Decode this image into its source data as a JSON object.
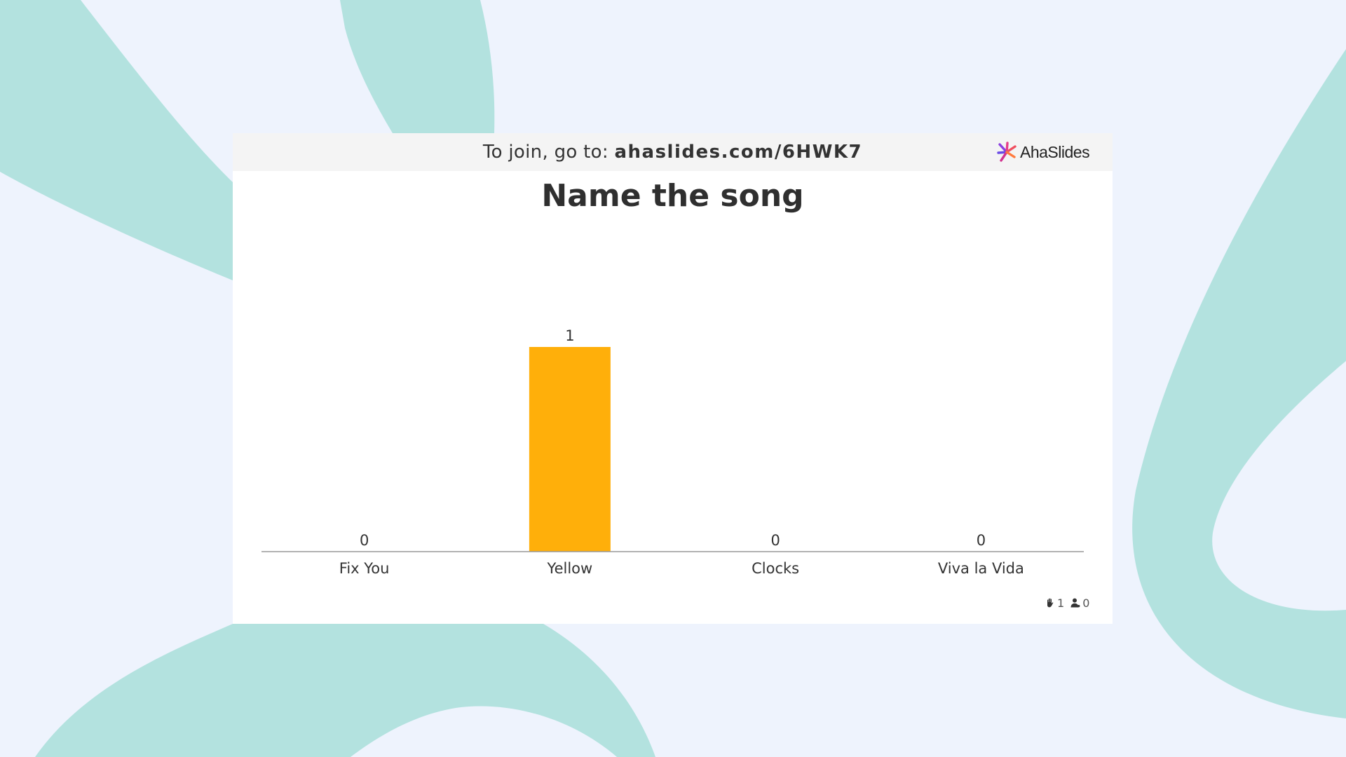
{
  "header": {
    "join_prefix": "To join, go to: ",
    "join_url": "ahaslides.com/6HWK7",
    "brand_name": "AhaSlides",
    "brand_icon": "ahaslides-burst-icon"
  },
  "slide": {
    "title": "Name the song"
  },
  "footer": {
    "responses_icon": "hand-icon",
    "responses_count": "1",
    "participants_icon": "person-icon",
    "participants_count": "0"
  },
  "colors": {
    "background": "#eef3fd",
    "background_shape": "#b3e2df",
    "bar": "#ffaf0a",
    "axis": "#999999",
    "text": "#333333"
  },
  "chart_data": {
    "type": "bar",
    "categories": [
      "Fix You",
      "Yellow",
      "Clocks",
      "Viva la Vida"
    ],
    "values": [
      0,
      1,
      0,
      0
    ],
    "title": "Name the song",
    "xlabel": "",
    "ylabel": "",
    "ylim": [
      0,
      1
    ],
    "grid": false,
    "legend": "none",
    "data_labels": true
  }
}
